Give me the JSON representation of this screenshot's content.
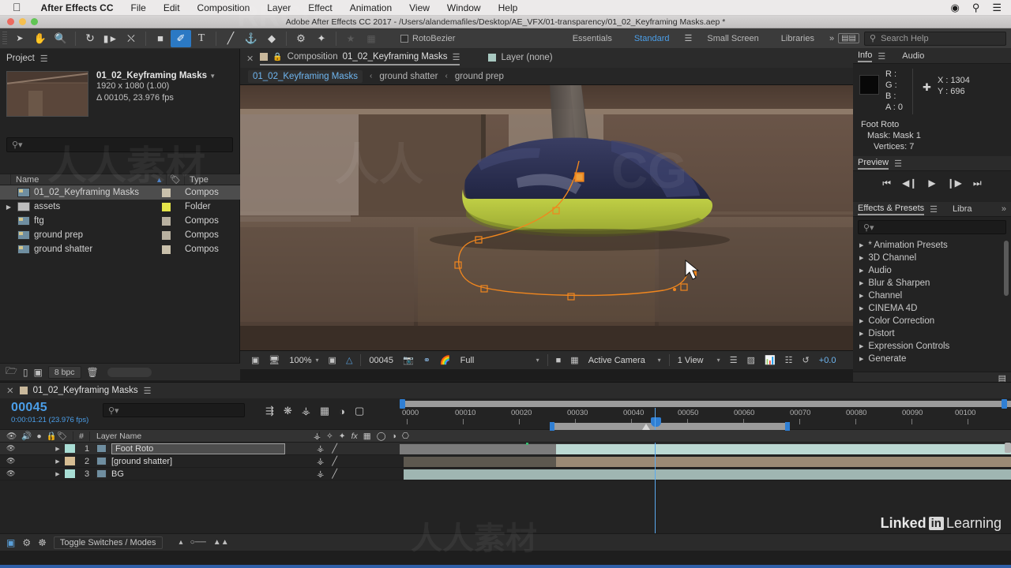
{
  "macmenu": {
    "apple": "apple-logo",
    "items": [
      "After Effects CC",
      "File",
      "Edit",
      "Composition",
      "Layer",
      "Effect",
      "Animation",
      "View",
      "Window",
      "Help"
    ],
    "right_icons": [
      "display-icon",
      "search-icon",
      "list-icon"
    ]
  },
  "titlebar": {
    "title": "Adobe After Effects CC 2017 - /Users/alandemafiles/Desktop/AE_VFX/01-transparency/01_02_Keyframing Masks.aep *"
  },
  "toolbar": {
    "tools": [
      {
        "name": "selection-tool",
        "glyph": "➤"
      },
      {
        "name": "hand-tool",
        "glyph": "✋"
      },
      {
        "name": "zoom-tool",
        "glyph": "⚲"
      },
      {
        "name": "rotation-tool",
        "glyph": "↺"
      },
      {
        "name": "camera-tool",
        "glyph": "🎥"
      },
      {
        "name": "anchor-point-tool",
        "glyph": "⬚"
      },
      {
        "name": "shape-tool",
        "glyph": "■"
      },
      {
        "name": "pen-tool",
        "glyph": "✒"
      },
      {
        "name": "text-tool",
        "glyph": "T"
      },
      {
        "name": "brush-tool",
        "glyph": "╱"
      },
      {
        "name": "clone-stamp-tool",
        "glyph": "⚑"
      },
      {
        "name": "eraser-tool",
        "glyph": "◆"
      },
      {
        "name": "roto-brush-tool",
        "glyph": "⚒"
      },
      {
        "name": "puppet-pin-tool",
        "glyph": "★"
      }
    ],
    "selected_tool": "pen-tool",
    "rotobezier_label": "RotoBezier",
    "rotobezier_checked": false,
    "workspaces": [
      "Essentials",
      "Standard",
      "Small Screen",
      "Libraries"
    ],
    "workspace_active": "Standard",
    "overflow": "»",
    "search_placeholder": "Search Help"
  },
  "project": {
    "tab": "Project",
    "comp_name": "01_02_Keyframing Masks",
    "comp_res": "1920 x 1080 (1.00)",
    "comp_duration": "Δ 00105, 23.976 fps",
    "search_placeholder": "",
    "columns": [
      "Name",
      "Type"
    ],
    "items": [
      {
        "name": "01_02_Keyframing Masks",
        "type": "Compos",
        "icon": "composition-icon",
        "swatch": "#c9c0ab",
        "selected": true,
        "expandable": false
      },
      {
        "name": "assets",
        "type": "Folder",
        "icon": "folder-icon",
        "swatch": "#e4e44a",
        "selected": false,
        "expandable": true
      },
      {
        "name": "ftg",
        "type": "Compos",
        "icon": "composition-icon",
        "swatch": "#b8b0a0",
        "selected": false,
        "expandable": false
      },
      {
        "name": "ground prep",
        "type": "Compos",
        "icon": "composition-icon",
        "swatch": "#b8b0a0",
        "selected": false,
        "expandable": false
      },
      {
        "name": "ground shatter",
        "type": "Compos",
        "icon": "composition-icon",
        "swatch": "#c9c0ab",
        "selected": false,
        "expandable": false
      }
    ],
    "footer": {
      "bpc": "8 bpc"
    }
  },
  "composition": {
    "tabs": [
      {
        "label": "Composition",
        "value": "01_02_Keyframing Masks",
        "active": true,
        "swatch": "#c9b89b"
      },
      {
        "label": "Layer (none)",
        "value": "",
        "active": false,
        "swatch": "#a8c8c0"
      }
    ],
    "breadcrumb": [
      {
        "label": "01_02_Keyframing Masks",
        "active": true
      },
      {
        "label": "ground shatter",
        "active": false
      },
      {
        "label": "ground prep",
        "active": false
      }
    ],
    "footer": {
      "zoom": "100%",
      "frame": "00045",
      "resolution": "Full",
      "camera": "Active Camera",
      "views": "1 View",
      "exposure": "+0.0"
    }
  },
  "info": {
    "tabs": [
      "Info",
      "Audio"
    ],
    "active_tab": "Info",
    "R": "R :",
    "G": "G :",
    "B": "B :",
    "A": "A : 0",
    "X": "X : 1304",
    "Y": "Y : 696",
    "layer": "Foot Roto",
    "mask": "Mask: Mask 1",
    "vertices": "Vertices: 7"
  },
  "preview": {
    "tab": "Preview",
    "buttons": [
      "first-frame-button",
      "prev-frame-button",
      "play-button",
      "next-frame-button",
      "last-frame-button"
    ]
  },
  "effects": {
    "tabs": [
      "Effects & Presets",
      "Libra"
    ],
    "active_tab": "Effects & Presets",
    "overflow": "»",
    "search_placeholder": "",
    "categories": [
      "* Animation Presets",
      "3D Channel",
      "Audio",
      "Blur & Sharpen",
      "Channel",
      "CINEMA 4D",
      "Color Correction",
      "Distort",
      "Expression Controls",
      "Generate"
    ]
  },
  "timeline": {
    "tab": "01_02_Keyframing Masks",
    "timecode": "00045",
    "timecode_sub": "0:00:01:21 (23.976 fps)",
    "search_placeholder": "",
    "columns": {
      "num": "#",
      "name": "Layer Name"
    },
    "ruler_labels": [
      "0000",
      "00010",
      "00020",
      "00030",
      "00040",
      "00050",
      "00060",
      "00070",
      "00080",
      "00090",
      "00100"
    ],
    "layers": [
      {
        "num": "1",
        "name": "Foot Roto",
        "color": "#a8ddd4",
        "selected": true,
        "bar_color": "#b5d8d2",
        "bar_start": 0,
        "bar_end": 100,
        "split_at": 26
      },
      {
        "num": "2",
        "name": "[ground shatter]",
        "color": "#d6bd93",
        "selected": false,
        "bar_color": "#a08f7d",
        "bar_start": 0,
        "bar_end": 100,
        "split_at": 15
      },
      {
        "num": "3",
        "name": "BG",
        "color": "#a8ddd4",
        "selected": false,
        "bar_color": "#93aeab",
        "bar_start": 0,
        "bar_end": 100,
        "split_at": -1
      }
    ],
    "footer": {
      "toggle": "Toggle Switches / Modes"
    }
  },
  "branding": {
    "linkedin": "Linked",
    "in": "in",
    "learning": "Learning"
  },
  "mask": {
    "name": "Mask 1",
    "stroke_color": "#f0861e",
    "vertex_count": 7
  },
  "colors": {
    "accent_blue": "#4b9ee8",
    "panel_bg": "#232323",
    "header_bg": "#2b2b2b",
    "mask_orange": "#f0861e"
  }
}
